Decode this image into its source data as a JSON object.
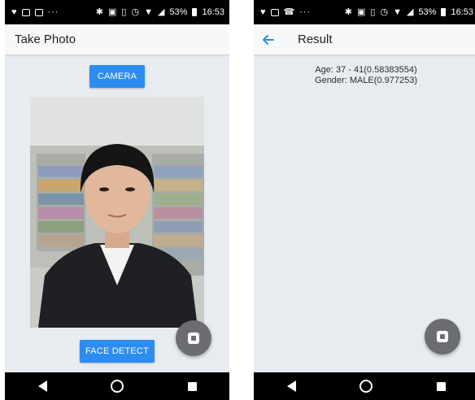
{
  "colors": {
    "accent": "#2d8cf0",
    "screen_bg": "#e8ecf0",
    "appbar_bg": "#f7f8f9",
    "fab": "#6b6d70"
  },
  "left_screen": {
    "status": {
      "dots": "···",
      "battery": "53%",
      "time": "16:53",
      "icons": [
        "notification-icon",
        "image-icon",
        "cast-icon",
        "bluetooth-icon",
        "nfc-icon",
        "vibrate-icon",
        "alarm-icon",
        "data-icon",
        "wifi-icon",
        "signal-icon",
        "battery-icon"
      ]
    },
    "appbar": {
      "title": "Take Photo"
    },
    "camera_button": "CAMERA",
    "face_detect_button": "FACE DETECT"
  },
  "right_screen": {
    "status": {
      "dots": "···",
      "battery": "53%",
      "time": "16:53",
      "icons": [
        "notification-icon",
        "cast-icon",
        "call-icon",
        "bluetooth-icon",
        "nfc-icon",
        "vibrate-icon",
        "alarm-icon",
        "data-icon",
        "wifi-icon",
        "signal-icon",
        "battery-icon"
      ]
    },
    "appbar": {
      "title": "Result",
      "back_icon": "arrow-left-icon"
    },
    "result": {
      "age": "Age: 37 - 41(0.58383554)",
      "gender": "Gender: MALE(0.977253)"
    }
  }
}
